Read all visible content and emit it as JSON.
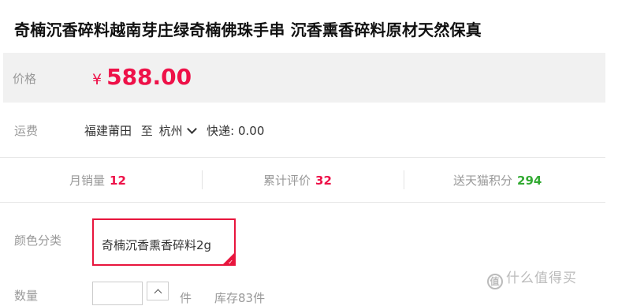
{
  "product": {
    "title": "奇楠沉香碎料越南芽庄绿奇楠佛珠手串 沉香熏香碎料原材天然保真"
  },
  "price": {
    "label": "价格",
    "currency": "¥",
    "value": "588.00",
    "color": "#ee1148"
  },
  "shipping": {
    "label": "运费",
    "from": "福建莆田",
    "to_label": "至",
    "to_city": "杭州",
    "express": "快递: 0.00"
  },
  "stats": {
    "sales_label": "月销量",
    "sales_value": "12",
    "reviews_label": "累计评价",
    "reviews_value": "32",
    "points_label": "送天猫积分",
    "points_value": "294"
  },
  "options": {
    "color_label": "颜色分类",
    "selected_color": "奇楠沉香熏香碎料2g",
    "accent": "#e8153d"
  },
  "quantity": {
    "label": "数量",
    "unit": "件",
    "stock": "库存83件"
  },
  "watermark": {
    "text": "什么值得买",
    "icon": "zhi-logo-icon"
  }
}
